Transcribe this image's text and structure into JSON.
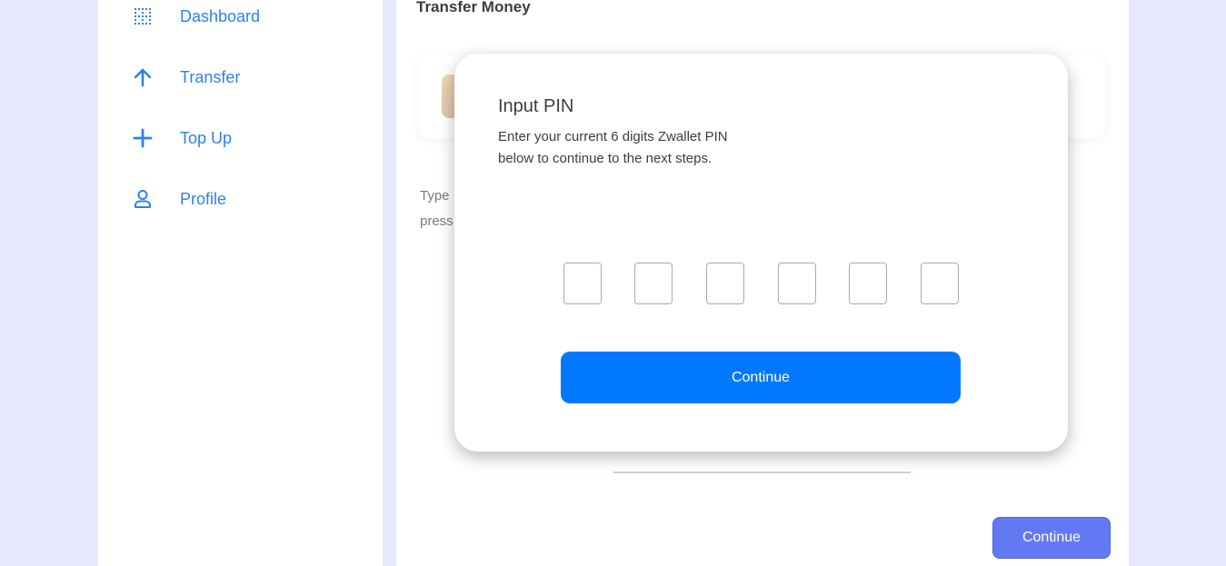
{
  "sidebar": {
    "items": [
      {
        "label": "Dashboard",
        "icon": "grid-icon"
      },
      {
        "label": "Transfer",
        "icon": "arrow-up-icon"
      },
      {
        "label": "Top Up",
        "icon": "plus-icon"
      },
      {
        "label": "Profile",
        "icon": "user-icon"
      }
    ]
  },
  "main": {
    "title": "Transfer Money",
    "helper_line1": "Type",
    "helper_line2": "press",
    "continue_label": "Continue"
  },
  "modal": {
    "title": "Input PIN",
    "description_line1": "Enter your current 6 digits Zwallet PIN",
    "description_line2": "below to continue to the next steps.",
    "pin_boxes": [
      "",
      "",
      "",
      "",
      "",
      ""
    ],
    "continue_label": "Continue"
  },
  "colors": {
    "background": "#e6e8fb",
    "accent_blue": "#0278ff",
    "nav_blue": "#2f80ed",
    "main_button": "#6379f4"
  }
}
